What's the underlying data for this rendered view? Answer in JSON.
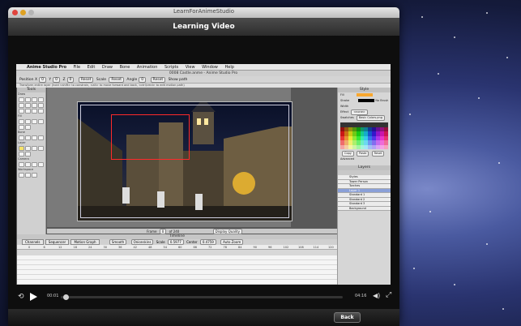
{
  "window": {
    "title": "LearnForAnimeStudio",
    "header": "Learning Video"
  },
  "app": {
    "menus": [
      "Anime Studio Pro",
      "File",
      "Edit",
      "Draw",
      "Bone",
      "Animation",
      "Scripts",
      "View",
      "Window",
      "Help"
    ],
    "doc_title": "0008 Castle.anme - Anime Studio Pro",
    "tool_options": {
      "position_label": "Position",
      "x_label": "X",
      "y_label": "Y",
      "z_label": "Z",
      "x_val": "0",
      "y_val": "0",
      "z_val": "0",
      "reset1": "Reset",
      "scale_label": "Scale",
      "reset2": "Reset",
      "angle_label": "Angle",
      "angle_val": "0",
      "reset3": "Reset",
      "show_path": "Show path"
    },
    "hint": "Transform entire layer (hold <shift> to constrain, <alt> to move forward and back, <ctrl/cmd> to edit motion path)",
    "tools": {
      "title": "Tools",
      "groups": [
        "Draw",
        "Fill",
        "Bone",
        "Layer",
        "Camera",
        "Workspace"
      ]
    },
    "style": {
      "title": "Style",
      "fill": "Fill",
      "stroke": "Stroke",
      "width": "Width",
      "effect": "Effect",
      "effect_val": "<none>",
      "no_brush": "No Brush",
      "swatches": "Swatches",
      "swatch_set": "Basic Colors.png",
      "copy": "Copy",
      "paste": "Paste",
      "reset": "Reset",
      "advanced": "Advanced"
    },
    "layers": {
      "title": "Layers",
      "items": [
        "Styles",
        "Tower Person",
        "Torches",
        "Layer 1",
        "Standard 1",
        "Standard 2",
        "Standard 3",
        "Background"
      ],
      "selected": 3
    },
    "frame": {
      "label": "Frame",
      "val": "0",
      "of": "of 240",
      "display_quality": "Display Quality"
    },
    "timeline": {
      "title": "Timeline",
      "tabs": [
        "Channels",
        "Sequencer",
        "Motion Graph"
      ],
      "interp": "Smooth",
      "interp2": "Onionskins",
      "scale_label": "Scale",
      "scale_val": "0.5977",
      "center_label": "Center",
      "center_val": "0.4759",
      "auto_zoom": "Auto Zoom",
      "ruler": [
        "0",
        "6",
        "12",
        "18",
        "24",
        "30",
        "36",
        "42",
        "48",
        "54",
        "60",
        "66",
        "72",
        "78",
        "84",
        "90",
        "96",
        "102",
        "108",
        "114",
        "120"
      ]
    }
  },
  "player": {
    "elapsed": "00:01",
    "remaining": "04:16",
    "progress": 0.01
  },
  "footer": {
    "back": "Back"
  }
}
